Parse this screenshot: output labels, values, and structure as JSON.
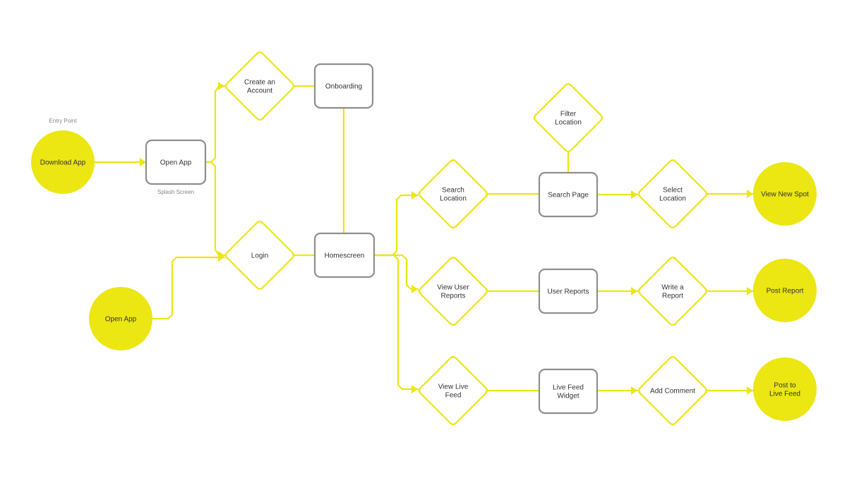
{
  "diagram": {
    "type": "user-flow",
    "colors": {
      "accent": "#ECE613",
      "box_stroke": "#8E8E8E",
      "text": "#333333",
      "caption": "#888888",
      "background": "#FFFFFF"
    },
    "nodes": [
      {
        "id": "download-app",
        "shape": "circle",
        "label": "Download App",
        "caption_above": "Entry Point"
      },
      {
        "id": "open-app-screen",
        "shape": "box",
        "label": "Open App",
        "caption_below": "Splash Screen"
      },
      {
        "id": "create-account",
        "shape": "diamond",
        "label": "Create an\nAccount"
      },
      {
        "id": "onboarding",
        "shape": "box",
        "label": "Onboarding"
      },
      {
        "id": "login",
        "shape": "diamond",
        "label": "Login"
      },
      {
        "id": "homescreen",
        "shape": "box",
        "label": "Homescreen"
      },
      {
        "id": "open-app-entry",
        "shape": "circle",
        "label": "Open App"
      },
      {
        "id": "search-location",
        "shape": "diamond",
        "label": "Search\nLocation"
      },
      {
        "id": "search-page",
        "shape": "box",
        "label": "Search Page"
      },
      {
        "id": "filter-location",
        "shape": "diamond",
        "label": "Filter\nLocation"
      },
      {
        "id": "select-location",
        "shape": "diamond",
        "label": "Select\nLocation"
      },
      {
        "id": "view-new-spot",
        "shape": "circle",
        "label": "View New Spot"
      },
      {
        "id": "view-user-reports",
        "shape": "diamond",
        "label": "View User\nReports"
      },
      {
        "id": "user-reports",
        "shape": "box",
        "label": "User Reports"
      },
      {
        "id": "write-report",
        "shape": "diamond",
        "label": "Write a\nReport"
      },
      {
        "id": "post-report",
        "shape": "circle",
        "label": "Post Report"
      },
      {
        "id": "view-live-feed",
        "shape": "diamond",
        "label": "View Live\nFeed"
      },
      {
        "id": "live-feed-widget",
        "shape": "box",
        "label": "Live Feed\nWidget"
      },
      {
        "id": "add-comment",
        "shape": "diamond",
        "label": "Add Comment"
      },
      {
        "id": "post-live-feed",
        "shape": "circle",
        "label": "Post to\nLive Feed"
      }
    ],
    "edges": [
      {
        "from": "download-app",
        "to": "open-app-screen",
        "arrow": true
      },
      {
        "from": "open-app-screen",
        "to": "create-account",
        "arrow": true
      },
      {
        "from": "open-app-screen",
        "to": "login",
        "arrow": true
      },
      {
        "from": "create-account",
        "to": "onboarding",
        "arrow": false
      },
      {
        "from": "onboarding",
        "to": "homescreen",
        "arrow": false
      },
      {
        "from": "open-app-entry",
        "to": "login",
        "arrow": true
      },
      {
        "from": "login",
        "to": "homescreen",
        "arrow": false
      },
      {
        "from": "homescreen",
        "to": "search-location",
        "arrow": true
      },
      {
        "from": "homescreen",
        "to": "view-user-reports",
        "arrow": true
      },
      {
        "from": "homescreen",
        "to": "view-live-feed",
        "arrow": true
      },
      {
        "from": "search-location",
        "to": "search-page",
        "arrow": false
      },
      {
        "from": "filter-location",
        "to": "search-page",
        "arrow": false
      },
      {
        "from": "search-page",
        "to": "select-location",
        "arrow": true
      },
      {
        "from": "select-location",
        "to": "view-new-spot",
        "arrow": true
      },
      {
        "from": "view-user-reports",
        "to": "user-reports",
        "arrow": false
      },
      {
        "from": "user-reports",
        "to": "write-report",
        "arrow": true
      },
      {
        "from": "write-report",
        "to": "post-report",
        "arrow": true
      },
      {
        "from": "view-live-feed",
        "to": "live-feed-widget",
        "arrow": false
      },
      {
        "from": "live-feed-widget",
        "to": "add-comment",
        "arrow": true
      },
      {
        "from": "add-comment",
        "to": "post-live-feed",
        "arrow": true
      }
    ]
  }
}
